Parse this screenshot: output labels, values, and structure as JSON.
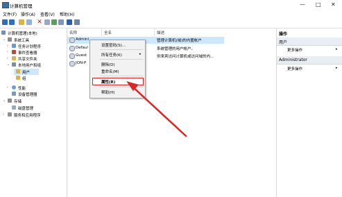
{
  "window": {
    "title": "计算机管理",
    "controls": [
      "minimize-icon",
      "maximize-icon",
      "close-icon"
    ]
  },
  "menubar": {
    "items": [
      "文件(F)",
      "操作(A)",
      "查看(V)",
      "帮助(H)"
    ]
  },
  "toolbar": {
    "icons": [
      "back-arrow-icon",
      "forward-arrow-icon",
      "up-folder-icon",
      "properties-icon",
      "delete-icon",
      "properties-sheet-icon",
      "refresh-icon",
      "export-icon",
      "help-icon",
      "view-icon"
    ]
  },
  "tree": {
    "root": "计算机管理(本地)",
    "system_tools": "系统工具",
    "task_scheduler": "任务计划程序",
    "event_viewer": "事件查看器",
    "shared_folders": "共享文件夹",
    "local_users_groups": "本地用户和组",
    "users": "用户",
    "groups": "组",
    "performance": "性能",
    "device_manager": "设备管理器",
    "storage": "存储",
    "disk_management": "磁盘管理",
    "services_apps": "服务和应用程序"
  },
  "list": {
    "headers": {
      "name": "名称",
      "fullname": "全名",
      "description": "描述"
    },
    "rows": [
      {
        "name": "Admini",
        "fullname": "",
        "description": "管理计算机(域)的内置帐户"
      },
      {
        "name": "Defaul",
        "fullname": "",
        "description": "系统管理的用户帐户。"
      },
      {
        "name": "Guest",
        "fullname": "",
        "description": "供来宾访问计算机或访问域的内..."
      },
      {
        "name": "JON-P",
        "fullname": "",
        "description": ""
      }
    ]
  },
  "context_menu": {
    "set_password": "设置密码(S)...",
    "all_tasks": "所有任务(K)",
    "delete": "删除(D)",
    "rename": "重命名(M)",
    "properties": "属性(R)",
    "help": "帮助(H)"
  },
  "actions": {
    "title": "操作",
    "section1": "用户",
    "more1": "更多操作",
    "section2": "Administrator",
    "more2": "更多操作"
  },
  "colors": {
    "selection": "#cce8ff",
    "annotation": "#e02424"
  }
}
